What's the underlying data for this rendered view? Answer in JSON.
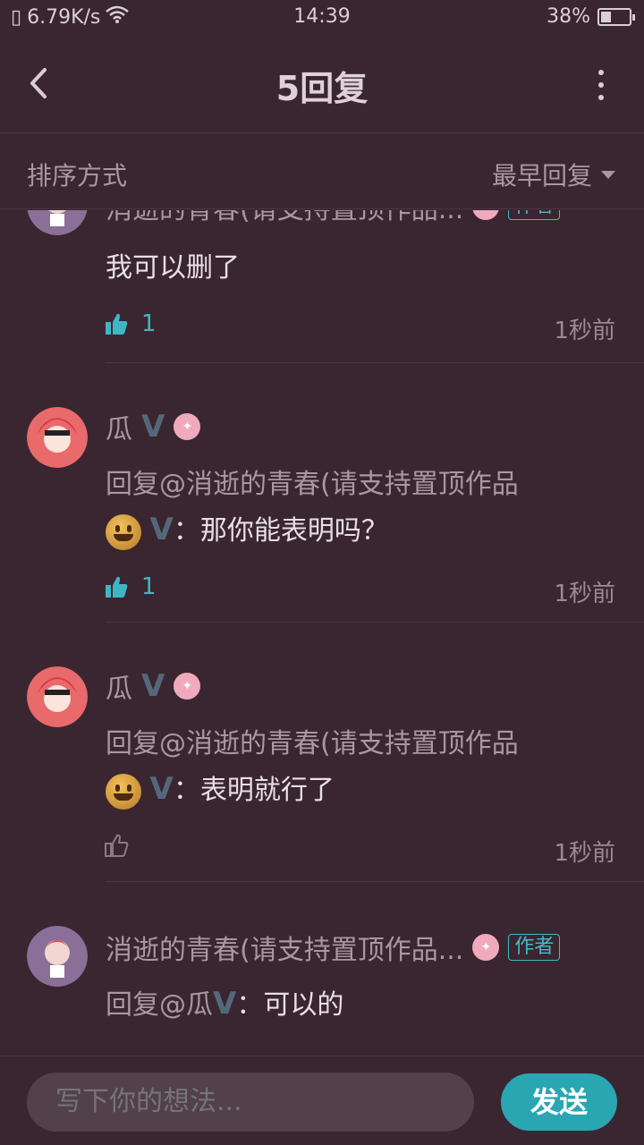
{
  "status_bar": {
    "net_speed": "6.79K/s",
    "time": "14:39",
    "battery": "38%",
    "battery_level": 0.38
  },
  "header": {
    "title": "5回复"
  },
  "sort": {
    "label": "排序方式",
    "value": "最早回复"
  },
  "comments": [
    {
      "user": "消逝的青春(请支持置顶作品...",
      "author_tag": "作者",
      "text": "我可以删了",
      "likes": "1",
      "time": "1秒前"
    },
    {
      "user": "瓜",
      "v": "V",
      "reply_prefix": "回复@消逝的青春(请支持置顶作品",
      "v2": "V",
      "text": "：那你能表明吗？",
      "likes": "1",
      "time": "1秒前"
    },
    {
      "user": "瓜",
      "v": "V",
      "reply_prefix": "回复@消逝的青春(请支持置顶作品",
      "v2": "V",
      "text": "：表明就行了",
      "time": "1秒前"
    },
    {
      "user": "消逝的青春(请支持置顶作品...",
      "author_tag": "作者",
      "reply_prefix": "回复@瓜",
      "v2": "V",
      "text": "：可以的"
    }
  ],
  "composer": {
    "placeholder": "写下你的想法...",
    "send_label": "发送"
  },
  "colors": {
    "background": "#3a2630",
    "accent": "#2aa6b3",
    "like": "#3fb6c6"
  }
}
